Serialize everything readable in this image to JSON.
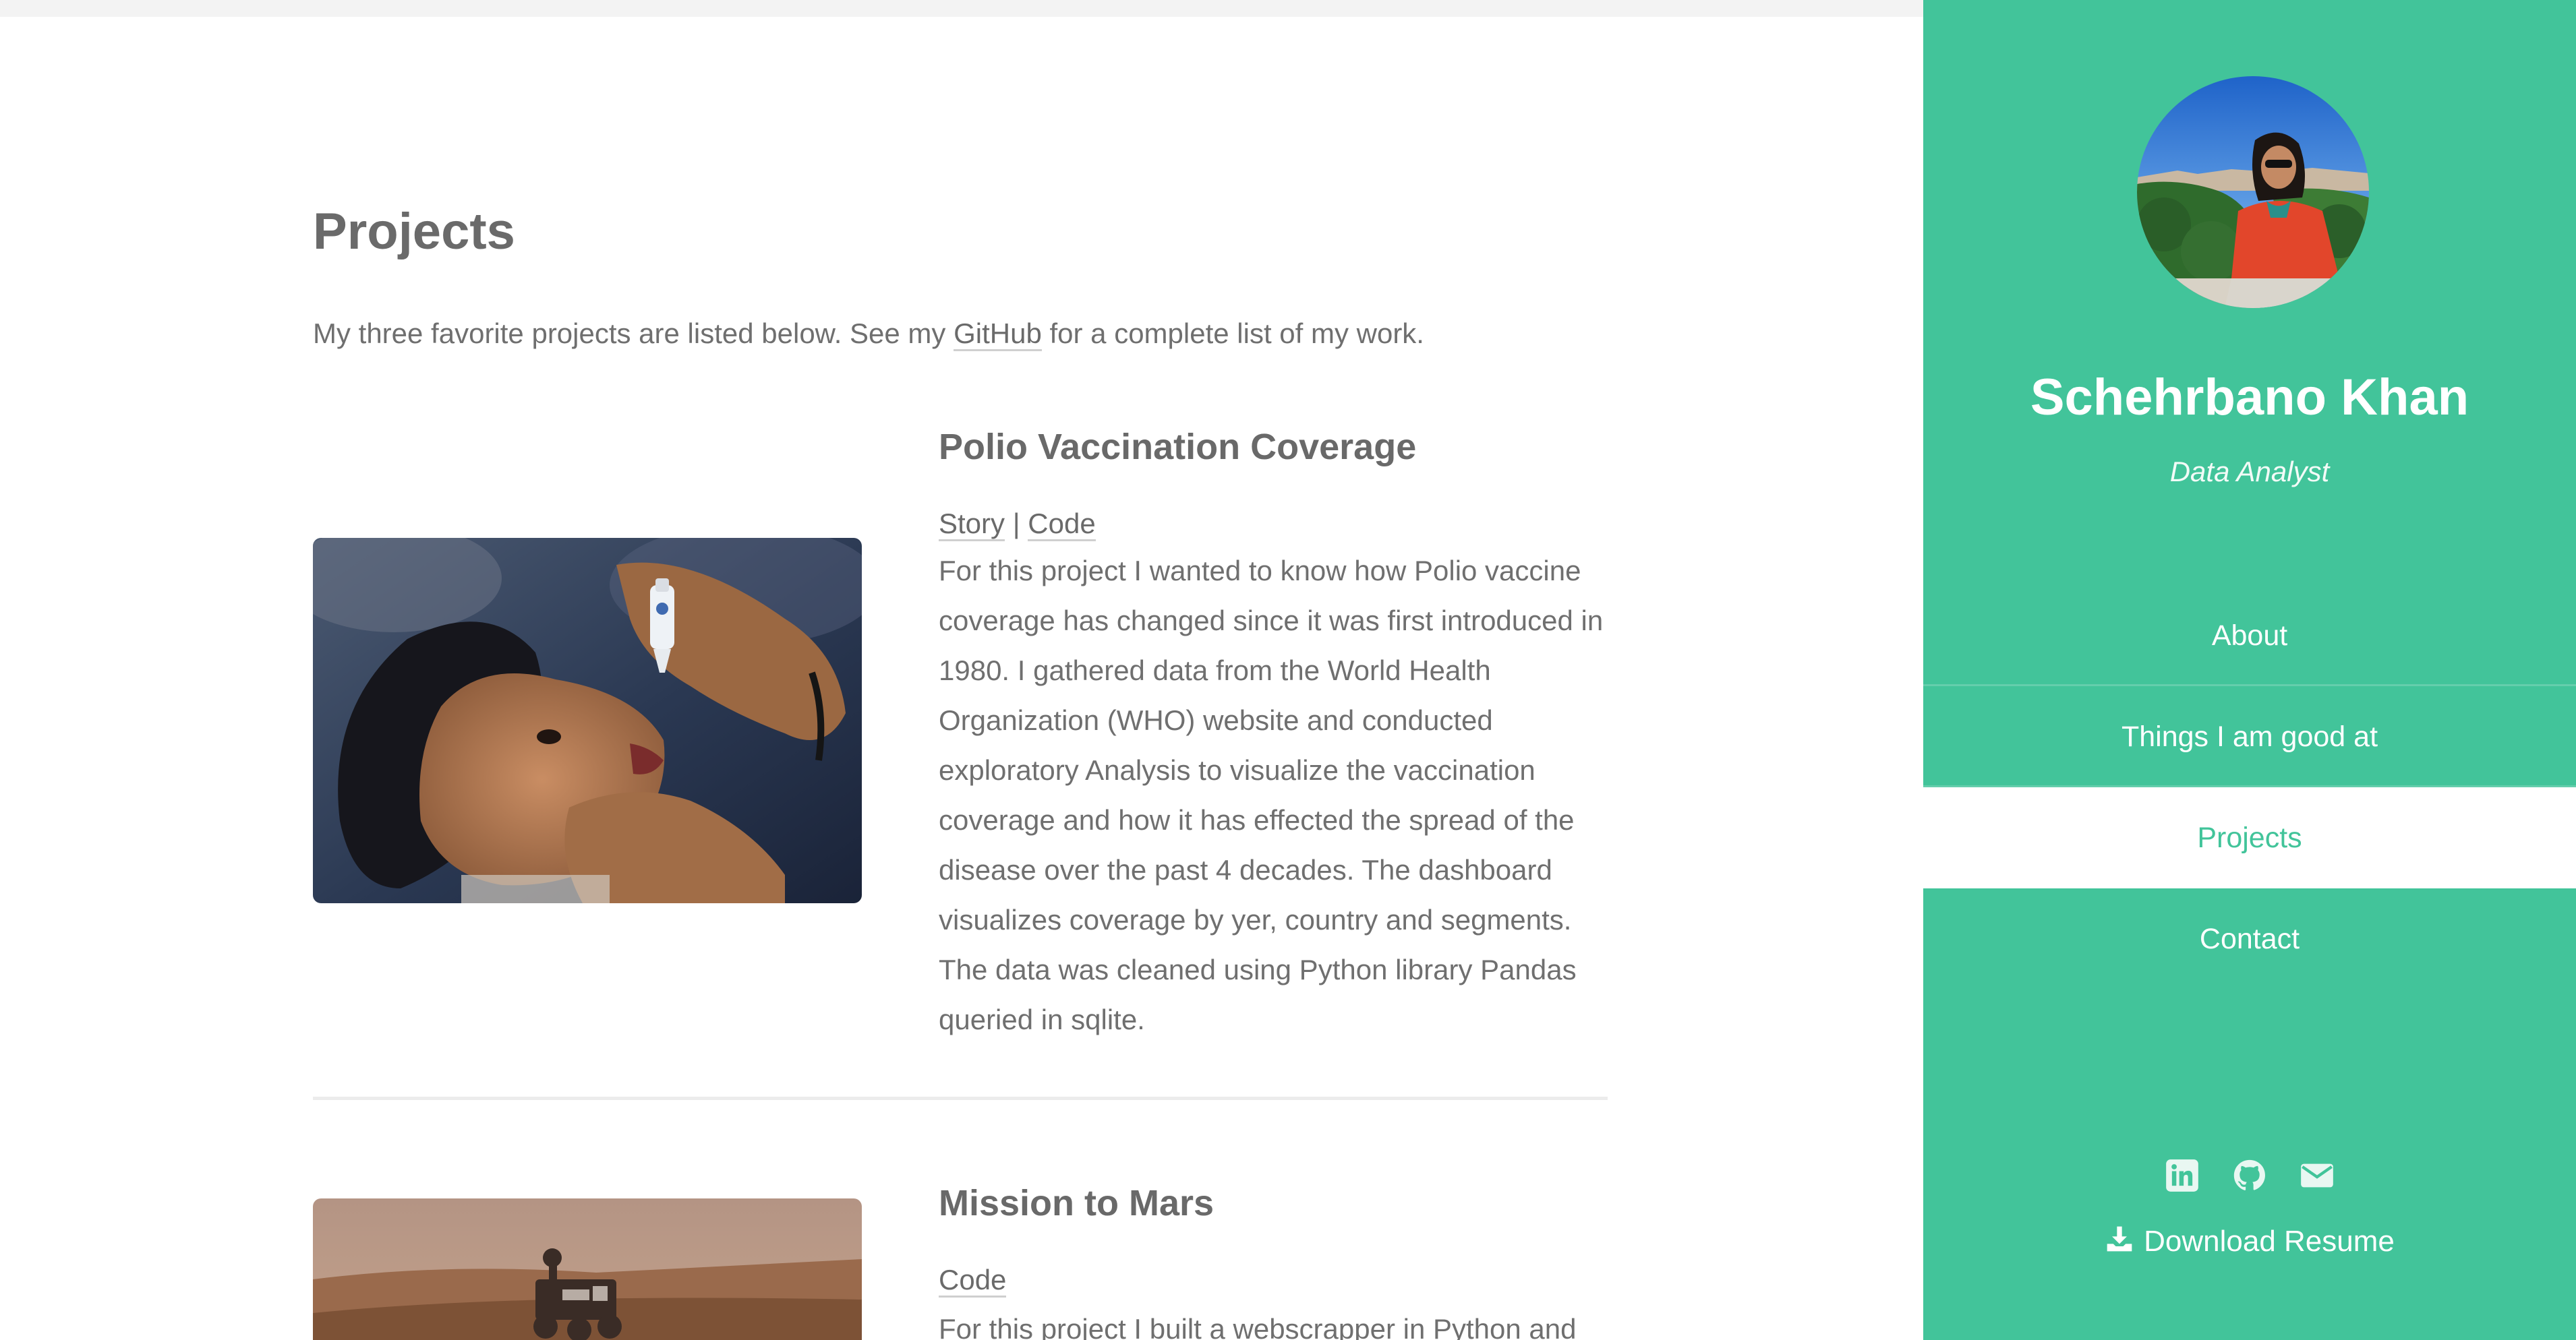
{
  "main": {
    "title": "Projects",
    "intro": {
      "before": "My three favorite projects are listed below. See my ",
      "link": "GitHub",
      "after": " for a complete list of my work."
    },
    "projects": [
      {
        "title": "Polio Vaccination Coverage",
        "story_label": "Story",
        "separator": " | ",
        "code_label": "Code",
        "description": "For this project I wanted to know how Polio vaccine coverage has changed since it was first introduced in 1980. I gathered data from the World Health Organization (WHO) website and conducted exploratory Analysis to visualize the vaccination coverage and how it has effected the spread of the disease over the past 4 decades. The dashboard visualizes coverage by yer, country and segments. The data was cleaned using Python library Pandas queried in sqlite."
      },
      {
        "title": "Mission to Mars",
        "code_label": "Code",
        "description": "For this project I built a webscrapper in Python and"
      }
    ]
  },
  "sidebar": {
    "name": "Schehrbano Khan",
    "role": "Data Analyst",
    "nav": [
      "About",
      "Things I am good at",
      "Projects",
      "Contact"
    ],
    "active_nav": "Projects",
    "social_icons": [
      "linkedin-icon",
      "github-icon",
      "email-icon"
    ],
    "resume_label": "Download Resume"
  },
  "colors": {
    "accent": "#42c49a",
    "text": "#6b6b6b",
    "white": "#ffffff"
  }
}
